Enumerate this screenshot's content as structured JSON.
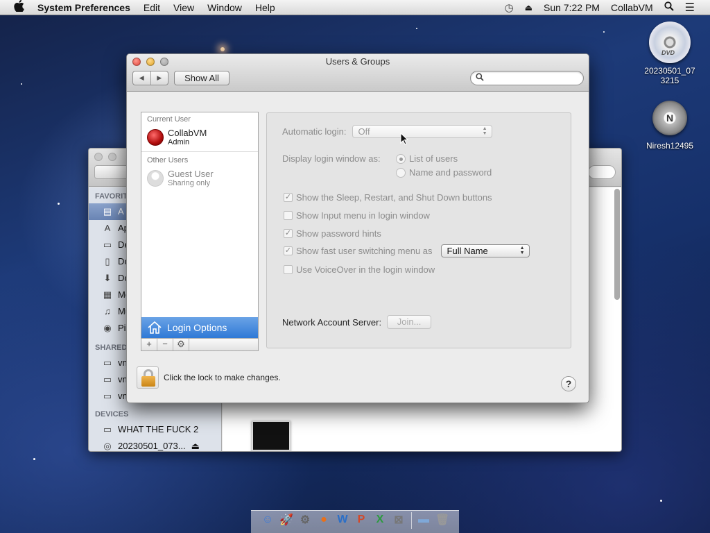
{
  "menubar": {
    "apple": "",
    "app": "System Preferences",
    "items": [
      "Edit",
      "View",
      "Window",
      "Help"
    ],
    "clock": "Sun 7:22 PM",
    "user": "CollabVM"
  },
  "desktop": {
    "disc_label": "20230501_07\n3215",
    "disc_line1": "20230501_07",
    "disc_line2": "3215",
    "disc_badge": "DVD",
    "drive_label": "Niresh12495",
    "drive_badge": "N"
  },
  "finder": {
    "sections": {
      "favorites": "FAVORIT",
      "shared": "SHARED",
      "devices": "DEVICES"
    },
    "favorites": [
      {
        "label": "A",
        "icon": "all-files-icon",
        "selected": true
      },
      {
        "label": "Ap",
        "icon": "applications-icon"
      },
      {
        "label": "De",
        "icon": "desktop-icon"
      },
      {
        "label": "Do",
        "icon": "documents-icon"
      },
      {
        "label": "Do",
        "icon": "downloads-icon"
      },
      {
        "label": "Mo",
        "icon": "movies-icon"
      },
      {
        "label": "Mu",
        "icon": "music-icon"
      },
      {
        "label": "Pic",
        "icon": "pictures-icon"
      }
    ],
    "shared": [
      {
        "label": "vn",
        "icon": "monitor-icon"
      },
      {
        "label": "vn",
        "icon": "monitor-icon"
      },
      {
        "label": "vn",
        "icon": "monitor-icon"
      }
    ],
    "devices": [
      {
        "label": "WHAT THE FUCK 2",
        "icon": "disk-icon"
      },
      {
        "label": "20230501_073...",
        "icon": "dvd-icon",
        "eject": "⏏"
      }
    ]
  },
  "prefs": {
    "title": "Users & Groups",
    "show_all": "Show All",
    "search_placeholder": "",
    "current_user_header": "Current User",
    "current_user": {
      "name": "CollabVM",
      "role": "Admin"
    },
    "other_users_header": "Other Users",
    "guest_user": {
      "name": "Guest User",
      "role": "Sharing only"
    },
    "login_options": "Login Options",
    "list_buttons": [
      "+",
      "−",
      "⚙"
    ],
    "automatic_login_label": "Automatic login:",
    "automatic_login_value": "Off",
    "display_login_label": "Display login window as:",
    "display_options": [
      "List of users",
      "Name and password"
    ],
    "display_selected": 0,
    "checkboxes": [
      {
        "label": "Show the Sleep, Restart, and Shut Down buttons",
        "checked": true
      },
      {
        "label": "Show Input menu in login window",
        "checked": false
      },
      {
        "label": "Show password hints",
        "checked": true
      },
      {
        "label": "Show fast user switching menu as",
        "checked": true
      },
      {
        "label": "Use VoiceOver in the login window",
        "checked": false
      }
    ],
    "fast_switch_value": "Full Name",
    "network_label": "Network Account Server:",
    "join_label": "Join...",
    "lock_text": "Click the lock to make changes.",
    "help": "?"
  },
  "dock": {
    "items": [
      {
        "icon": "finder-icon",
        "glyph": "☺",
        "color": "#3b7bd8"
      },
      {
        "icon": "launchpad-icon",
        "glyph": "🚀",
        "color": "#888"
      },
      {
        "icon": "system-prefs-icon",
        "glyph": "⚙",
        "color": "#666"
      },
      {
        "icon": "firefox-icon",
        "glyph": "●",
        "color": "#e8701a"
      },
      {
        "icon": "word-icon",
        "glyph": "W",
        "color": "#2b6fc7"
      },
      {
        "icon": "powerpoint-icon",
        "glyph": "P",
        "color": "#d2492a"
      },
      {
        "icon": "excel-icon",
        "glyph": "X",
        "color": "#2c9a3e"
      },
      {
        "icon": "utility-icon",
        "glyph": "⊠",
        "color": "#777"
      },
      {
        "icon": "folder-icon",
        "glyph": "▬",
        "color": "#7fa8d8"
      },
      {
        "icon": "trash-icon",
        "glyph": "🗑",
        "color": "#999"
      }
    ]
  }
}
